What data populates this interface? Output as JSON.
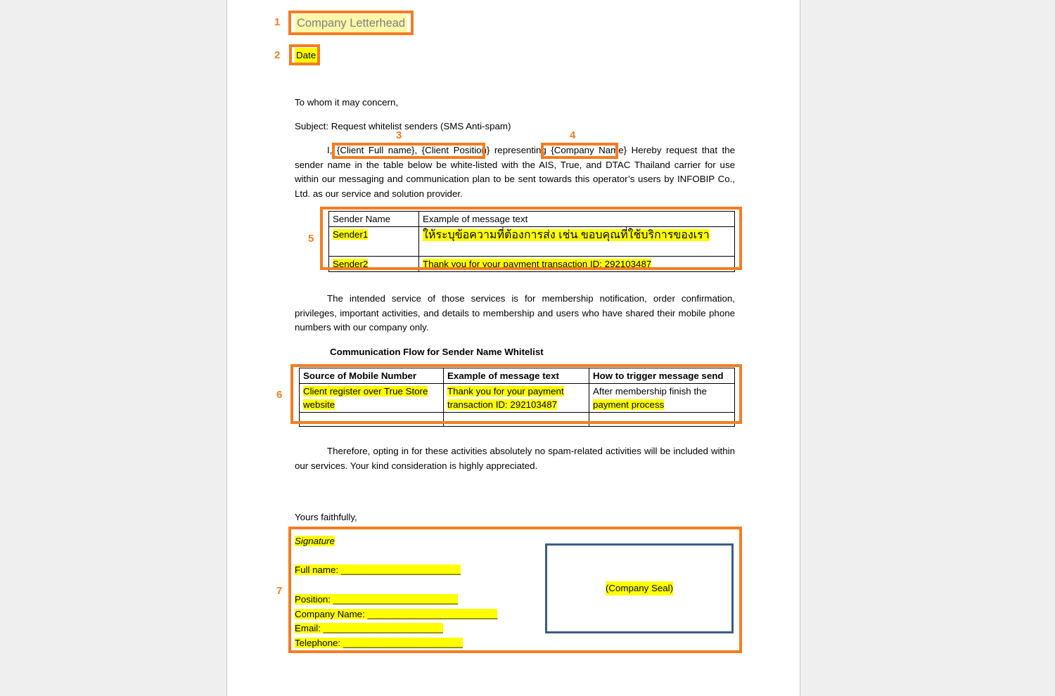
{
  "document": {
    "letterhead": "Company Letterhead",
    "date": "Date",
    "salutation": "To whom it may concern,",
    "subject": "Subject: Request whitelist senders (SMS Anti-spam)",
    "body_p1_before": "I, ",
    "body_p1_client": "{Client Full name}, {Client Position}",
    "body_p1_mid": " representing ",
    "body_p1_company": "{Company Name}",
    "body_p1_after": " Hereby request that the sender name in the table below be white-listed with the AIS, True, and DTAC Thailand carrier for use within our messaging and communication plan to be sent towards this operator’s users by INFOBIP Co., Ltd. as our service and solution provider.",
    "body_p2": "The intended service of those services is for membership notification, order confirmation, privileges, important activities, and details to membership and users who have shared their mobile phone numbers with our company only.",
    "flow_title": "Communication Flow for Sender Name Whitelist",
    "body_p3": "Therefore, opting in for these activities absolutely no spam-related activities will be included within our services. Your kind consideration is highly appreciated.",
    "closing": "Yours faithfully,"
  },
  "sender_table": {
    "headers": [
      "Sender Name",
      "Example of message text"
    ],
    "rows": [
      {
        "sender": "Sender1",
        "message": "ให้ระบุข้อความที่ต้องการส่ง เช่น ขอบคุณที่ใช้บริการของเรา"
      },
      {
        "sender": "Sender2",
        "message": "Thank you for your payment transaction ID: 292103487"
      }
    ]
  },
  "flow_table": {
    "headers": [
      "Source of Mobile Number",
      "Example of message text",
      "How to trigger message send"
    ],
    "rows": [
      {
        "source": "Client register over True Store website",
        "example": "Thank you for your payment transaction ID: 292103487",
        "trigger_plain": "After membership finish the ",
        "trigger_hl": "payment process"
      },
      {
        "source": "",
        "example": "",
        "trigger_plain": "",
        "trigger_hl": ""
      }
    ]
  },
  "signature": {
    "signature_label": "Signature",
    "full_name_label": "Full name: ",
    "full_name_blank": "_______________________",
    "position_label": "Position: ",
    "position_blank": "________________________",
    "company_label": "Company Name: ",
    "company_blank": "_________________________",
    "email_label": "Email: ",
    "email_blank": "_______________________",
    "telephone_label": "Telephone: ",
    "telephone_blank": "_______________________",
    "seal_text": "(Company Seal)"
  },
  "annotations": {
    "numbers": [
      "1",
      "2",
      "3",
      "4",
      "5",
      "6",
      "7"
    ],
    "accent_color": "#f57c20",
    "highlight_color": "#ffff00",
    "letterhead_highlight_color": "#fbf6a8",
    "seal_border_color": "#3c5c87"
  }
}
